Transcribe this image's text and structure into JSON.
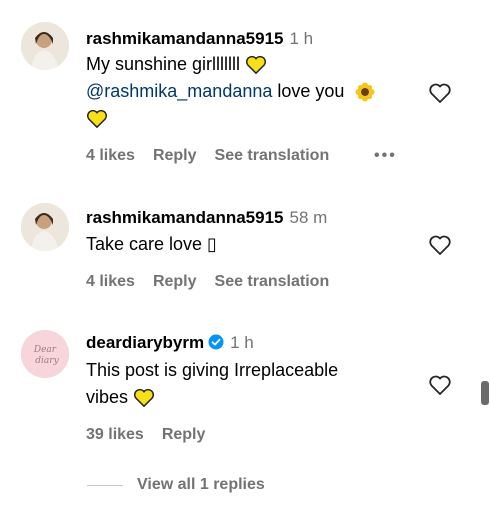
{
  "comments": [
    {
      "username": "rashmikamandanna5915",
      "time": "1 h",
      "line1": "My sunshine girlllllll",
      "mention": "@rashmika_mandanna",
      "line2_rest": " love you",
      "likes": "4 likes",
      "reply": "Reply",
      "translate": "See translation",
      "more": "•••"
    },
    {
      "username": "rashmikamandanna5915",
      "time": "58 m",
      "line1": "Take care love ▯",
      "likes": "4 likes",
      "reply": "Reply",
      "translate": "See translation"
    },
    {
      "username": "deardiarybyrm",
      "time": "1 h",
      "line1": "This post is giving Irreplaceable",
      "line2": "vibes",
      "likes": "39 likes",
      "reply": "Reply",
      "avatar_text": "Dear diary"
    }
  ],
  "view_replies": "View all 1 replies",
  "colors": {
    "secondary": "#737373",
    "mention": "#00376b",
    "verified": "#0095f6",
    "heart_yellow": "#f7e017"
  },
  "icons": [
    "heart-outline-icon",
    "yellow-heart-emoji",
    "sunflower-emoji",
    "verified-badge-icon",
    "more-dots-icon"
  ]
}
